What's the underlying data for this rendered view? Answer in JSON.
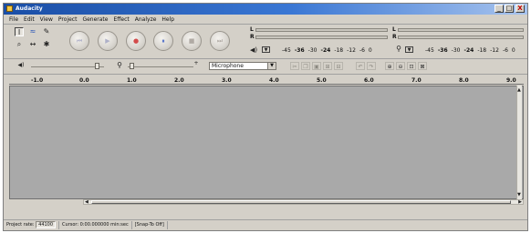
{
  "app": {
    "title": "Audacity"
  },
  "window_buttons": [
    "_",
    "□",
    "X"
  ],
  "menu": [
    "File",
    "Edit",
    "View",
    "Project",
    "Generate",
    "Effect",
    "Analyze",
    "Help"
  ],
  "tools": {
    "row1": [
      {
        "icon": "ibeam-icon",
        "glyph": "I"
      },
      {
        "icon": "envelope-icon",
        "glyph": "≈"
      },
      {
        "icon": "pencil-icon",
        "glyph": "✎"
      }
    ],
    "row2": [
      {
        "icon": "zoom-icon",
        "glyph": "⌕"
      },
      {
        "icon": "timeshift-icon",
        "glyph": "↔"
      },
      {
        "icon": "multi-tool-icon",
        "glyph": "✱"
      }
    ]
  },
  "transport": [
    {
      "icon": "skip-start-icon",
      "glyph": "⏮",
      "color": "#aeb0c8"
    },
    {
      "icon": "play-icon",
      "glyph": "▶",
      "color": "#aeb0c8"
    },
    {
      "icon": "record-icon",
      "glyph": "●",
      "color": "#d34b4b"
    },
    {
      "icon": "pause-icon",
      "glyph": "⏸",
      "color": "#3c5fc4"
    },
    {
      "icon": "stop-icon",
      "glyph": "■",
      "color": "#b0aaa4"
    },
    {
      "icon": "skip-end-icon",
      "glyph": "⏭",
      "color": "#b0aaa4"
    }
  ],
  "meters": {
    "left_label": "L",
    "right_label": "R",
    "play_scale": [
      "-45",
      "-36",
      "-30",
      "-24",
      "-18",
      "-12",
      "-6",
      "0"
    ],
    "rec_scale": [
      "-45",
      "-36",
      "-30",
      "-24",
      "-18",
      "-12",
      "-6",
      "0"
    ]
  },
  "mixer": {
    "input_source": "Microphone",
    "slider_max": "+"
  },
  "ruler": [
    "-1.0",
    "0.0",
    "1.0",
    "2.0",
    "3.0",
    "4.0",
    "5.0",
    "6.0",
    "7.0",
    "8.0",
    "9.0"
  ],
  "status": {
    "project_rate_label": "Project rate:",
    "project_rate": "44100",
    "cursor": "Cursor: 0:00.000000 min:sec",
    "snap": "[Snap-To Off]"
  },
  "colors": {
    "titlebar": "#2a62c8",
    "track_bg": "#a9a9a9",
    "chrome": "#d4d0c8"
  }
}
